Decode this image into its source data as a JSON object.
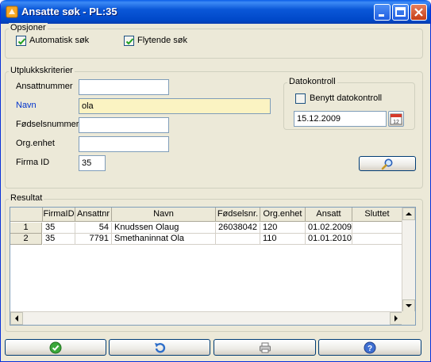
{
  "window": {
    "title": "Ansatte søk - PL:35"
  },
  "options": {
    "legend": "Opsjoner",
    "auto_search_label": "Automatisk søk",
    "auto_search_checked": true,
    "floating_search_label": "Flytende søk",
    "floating_search_checked": true
  },
  "criteria": {
    "legend": "Utplukkskriterier",
    "ansattnummer_label": "Ansattnummer",
    "ansattnummer_value": "",
    "navn_label": "Navn",
    "navn_value": "ola",
    "fodselsnummer_label": "Fødselsnummer",
    "fodselsnummer_value": "",
    "orgenhet_label": "Org.enhet",
    "orgenhet_value": "",
    "firmaid_label": "Firma ID",
    "firmaid_value": "35"
  },
  "datecontrol": {
    "legend": "Datokontroll",
    "use_label": "Benytt datokontroll",
    "use_checked": false,
    "date_value": "15.12.2009",
    "calendar_icon_text": "12"
  },
  "result": {
    "legend": "Resultat",
    "columns": [
      "FirmaID",
      "Ansattnr",
      "Navn",
      "Fødselsnr.",
      "Org.enhet",
      "Ansatt",
      "Sluttet"
    ],
    "rows": [
      {
        "num": "1",
        "cells": [
          "35",
          "54",
          "Knudssen Olaug",
          "26038042",
          "120",
          "01.02.2009",
          ""
        ]
      },
      {
        "num": "2",
        "cells": [
          "35",
          "7791",
          "Smethaninnat Ola",
          "",
          "110",
          "01.01.2010",
          ""
        ]
      }
    ]
  },
  "colors": {
    "title_bar": "#0054e3",
    "window_bg": "#ece9d8",
    "active_input": "#fbf3c2",
    "link_label": "#0033cc"
  },
  "icons": {
    "app": "app-icon",
    "search": "search-icon",
    "ok": "ok-check-icon",
    "undo": "undo-icon",
    "print": "print-icon",
    "help": "help-icon",
    "calendar": "calendar-icon"
  }
}
